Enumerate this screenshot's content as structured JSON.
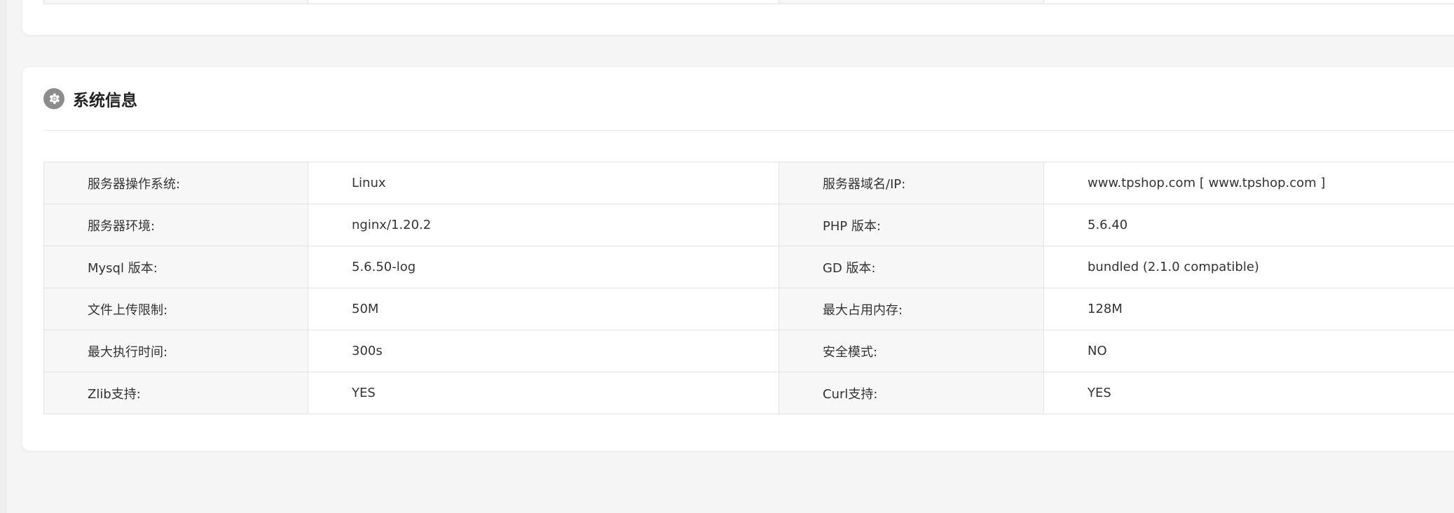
{
  "panel": {
    "title": "系统信息",
    "icon": "gear-icon"
  },
  "rows": [
    {
      "k1": "服务器操作系统:",
      "v1": "Linux",
      "k2": "服务器域名/IP:",
      "v2": "www.tpshop.com [ www.tpshop.com ]"
    },
    {
      "k1": "服务器环境:",
      "v1": "nginx/1.20.2",
      "k2": "PHP 版本:",
      "v2": "5.6.40"
    },
    {
      "k1": "Mysql 版本:",
      "v1": "5.6.50-log",
      "k2": "GD 版本:",
      "v2": "bundled (2.1.0 compatible)"
    },
    {
      "k1": "文件上传限制:",
      "v1": "50M",
      "k2": "最大占用内存:",
      "v2": "128M"
    },
    {
      "k1": "最大执行时间:",
      "v1": "300s",
      "k2": "安全模式:",
      "v2": "NO"
    },
    {
      "k1": "Zlib支持:",
      "v1": "YES",
      "k2": "Curl支持:",
      "v2": "YES"
    }
  ],
  "colors": {
    "page_bg": "#f5f5f5",
    "card_bg": "#ffffff",
    "label_bg": "#f7f7f7",
    "border": "#e2e2e2",
    "icon_bg": "#8c8c8c"
  }
}
